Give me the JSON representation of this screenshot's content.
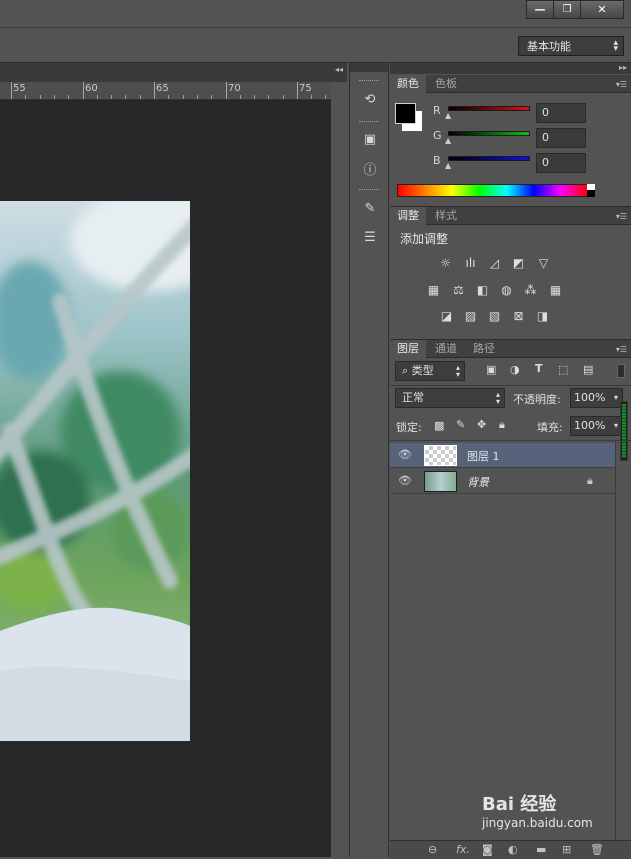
{
  "window": {
    "minimize_icon": "minimize-icon",
    "restore_icon": "restore-icon",
    "close_icon": "close-icon"
  },
  "options_bar": {
    "workspace_label": "基本功能"
  },
  "ruler": {
    "labels": [
      "55",
      "60",
      "65",
      "70",
      "75"
    ]
  },
  "color_panel": {
    "tabs": [
      "颜色",
      "色板"
    ],
    "channels": [
      {
        "label": "R",
        "value": "0",
        "color": "#e01010"
      },
      {
        "label": "G",
        "value": "0",
        "color": "#10c010"
      },
      {
        "label": "B",
        "value": "0",
        "color": "#1010e0"
      }
    ]
  },
  "adjustments_panel": {
    "tabs": [
      "调整",
      "样式"
    ],
    "heading": "添加调整"
  },
  "layers_panel": {
    "tabs": [
      "图层",
      "通道",
      "路径"
    ],
    "filter_label": "类型",
    "blend_mode": "正常",
    "opacity_label": "不透明度:",
    "opacity_value": "100%",
    "lock_label": "锁定:",
    "fill_label": "填充:",
    "fill_value": "100%",
    "layers": [
      {
        "name": "图层 1",
        "selected": true
      },
      {
        "name": "背景",
        "locked": true
      }
    ]
  },
  "watermark": {
    "text": "Bai 经验",
    "url": "jingyan.baidu.com"
  }
}
